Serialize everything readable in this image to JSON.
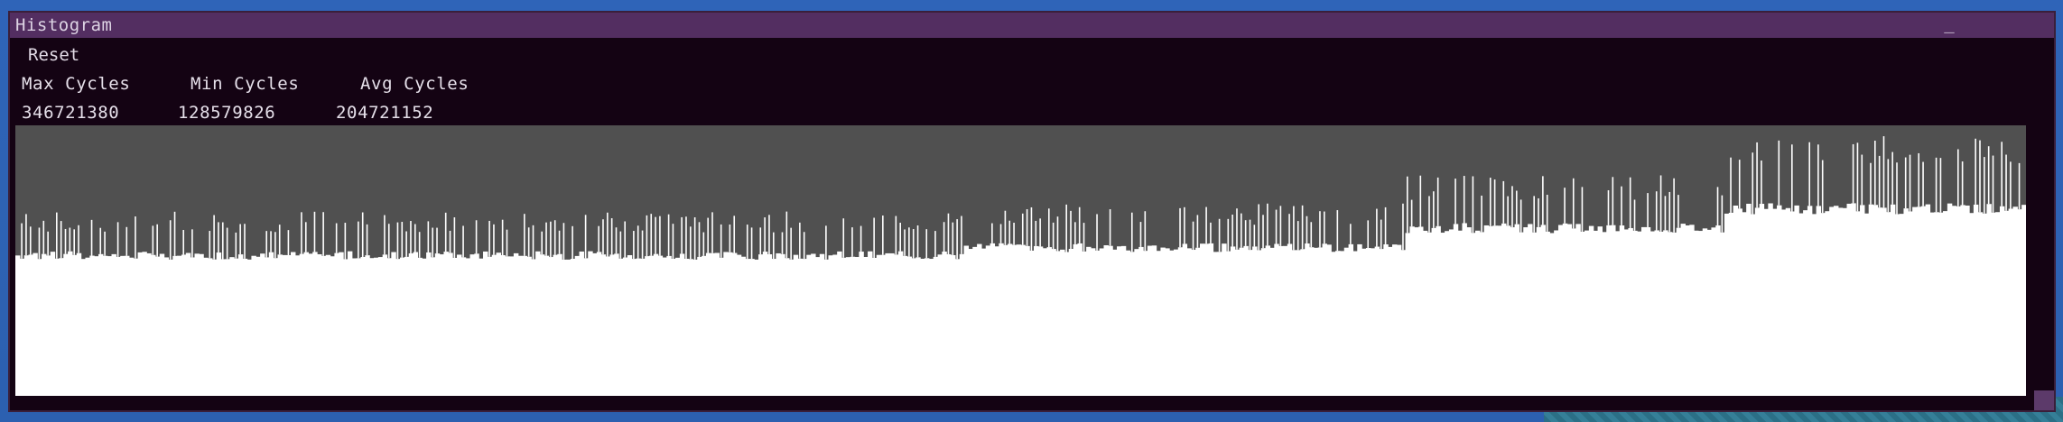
{
  "window": {
    "title": "Histogram",
    "minimize_label": "_"
  },
  "toolbar": {
    "reset_label": "Reset"
  },
  "stats": {
    "max_label": "Max Cycles",
    "min_label": "Min Cycles",
    "avg_label": "Avg Cycles",
    "max_value": "346721380",
    "min_value": "128579826",
    "avg_value": "204721152"
  },
  "colors": {
    "titlebar": "#532e61",
    "window_bg": "#140313",
    "plot_bg": "#505050",
    "bars": "#ffffff",
    "spikes": "#ffffff"
  },
  "chart_data": {
    "type": "bar",
    "title": "",
    "xlabel": "",
    "ylabel": "",
    "ylim": [
      0,
      346721380
    ],
    "sample_count": 460,
    "segments": [
      {
        "from": 0.0,
        "to": 0.47,
        "value": 180000000,
        "spike_value": 225000000
      },
      {
        "from": 0.47,
        "to": 0.69,
        "value": 190000000,
        "spike_value": 235000000
      },
      {
        "from": 0.69,
        "to": 0.85,
        "value": 215000000,
        "spike_value": 270000000
      },
      {
        "from": 0.85,
        "to": 1.0,
        "value": 240000000,
        "spike_value": 320000000
      }
    ]
  }
}
